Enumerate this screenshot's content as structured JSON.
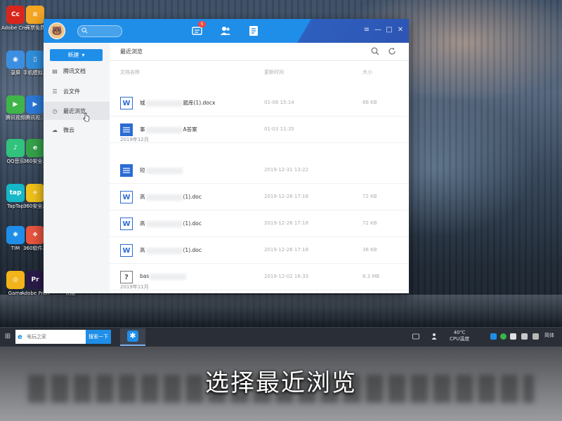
{
  "subtitle": "选择最近浏览",
  "desktop_icons": [
    {
      "label": "Adobe\nCreati...",
      "icon": "adobe-cc-icon",
      "color": "#d9261c",
      "glyph": "Cc"
    },
    {
      "label": "开票免费",
      "icon": "wifi-icon",
      "color": "#f5a623",
      "glyph": "≋"
    },
    {
      "label": "录屏",
      "icon": "screen-record-icon",
      "color": "#3c8fe0",
      "glyph": "◉"
    },
    {
      "label": "手机模拟...",
      "icon": "phone-emulator-icon",
      "color": "#2f8fdc",
      "glyph": "▯"
    },
    {
      "label": "腾讯视频",
      "icon": "tencent-video-icon",
      "color": "#3fb449",
      "glyph": "▶"
    },
    {
      "label": "腾讯视...",
      "icon": "tencent-video-icon",
      "color": "#2b7ad8",
      "glyph": "▶"
    },
    {
      "label": "QQ音乐",
      "icon": "qq-music-icon",
      "color": "#31c27c",
      "glyph": "♪"
    },
    {
      "label": "360安全...",
      "icon": "360-security-icon",
      "color": "#35a24a",
      "glyph": "e"
    },
    {
      "label": "TapTap",
      "icon": "taptap-icon",
      "color": "#16b7c6",
      "glyph": "tap"
    },
    {
      "label": "360安全...",
      "icon": "360-guard-icon",
      "color": "#f1c21b",
      "glyph": "+"
    },
    {
      "label": "TIM",
      "icon": "tim-icon",
      "color": "#1f8ee8",
      "glyph": "✱"
    },
    {
      "label": "360软件...",
      "icon": "360-software-icon",
      "color": "#e9553f",
      "glyph": "❖"
    },
    {
      "label": "Game",
      "icon": "game-icon",
      "color": "#f2b31b",
      "glyph": "◎"
    },
    {
      "label": "Adobe\nPremie...",
      "icon": "adobe-premiere-icon",
      "color": "#2a1a4a",
      "glyph": "Pr"
    },
    {
      "label": "优酷",
      "icon": "youku-icon",
      "color": "#1a6ee0",
      "glyph": "▶"
    }
  ],
  "window": {
    "search_placeholder": "",
    "message_badge": "5",
    "tabs": [
      "messages-icon",
      "contacts-icon",
      "documents-icon"
    ],
    "controls": [
      "menu-icon",
      "minimize-icon",
      "maximize-icon",
      "close-icon"
    ],
    "accent": "#1f8ee8",
    "sidebar": {
      "new_button": "新建",
      "new_arrow": "▾",
      "items": [
        {
          "label": "腾讯文档",
          "icon": "tencent-docs-icon",
          "active": false
        },
        {
          "label": "云文件",
          "icon": "cloud-file-icon",
          "active": false
        },
        {
          "label": "最近浏览",
          "icon": "clock-icon",
          "active": true
        },
        {
          "label": "微云",
          "icon": "weiyun-cloud-icon",
          "active": false
        }
      ]
    },
    "main": {
      "title": "最近浏览",
      "columns": {
        "name": "文档名称",
        "time": "更新时间",
        "size": "大小"
      },
      "groups": {
        "g2019_12": "2019年12月",
        "g2019_11": "2019年11月"
      },
      "files": [
        {
          "type": "word",
          "glyph": "W",
          "name_start": "城",
          "name_end": "题库(1).docx",
          "time": "01-06 15:14",
          "size": "86 KB"
        },
        {
          "type": "doc",
          "glyph": "≡",
          "name_start": "事",
          "name_end": "A答案",
          "time": "01-03 11:35",
          "size": ""
        },
        {
          "type": "doc",
          "glyph": "≡",
          "name_start": "短",
          "name_end": "",
          "time": "2019-12-31 13:22",
          "size": ""
        },
        {
          "type": "word",
          "glyph": "W",
          "name_start": "高",
          "name_end": "(1).doc",
          "time": "2019-12-26 17:18",
          "size": "72 KB"
        },
        {
          "type": "word",
          "glyph": "W",
          "name_start": "高",
          "name_end": "(1).doc",
          "time": "2019-12-26 17:18",
          "size": "72 KB"
        },
        {
          "type": "word",
          "glyph": "W",
          "name_start": "高",
          "name_end": "(1).doc",
          "time": "2019-12-26 17:18",
          "size": "36 KB"
        },
        {
          "type": "unknown",
          "glyph": "?",
          "name_start": "bas",
          "name_end": "",
          "time": "2019-12-02 16:33",
          "size": "8.3 MB"
        }
      ]
    }
  },
  "taskbar": {
    "start_glyph": "⊞",
    "search_placeholder": "电玩之家",
    "search_button": "搜索一下",
    "temperature": "40℃",
    "cpu_label": "CPU温度",
    "lang": "简体"
  }
}
